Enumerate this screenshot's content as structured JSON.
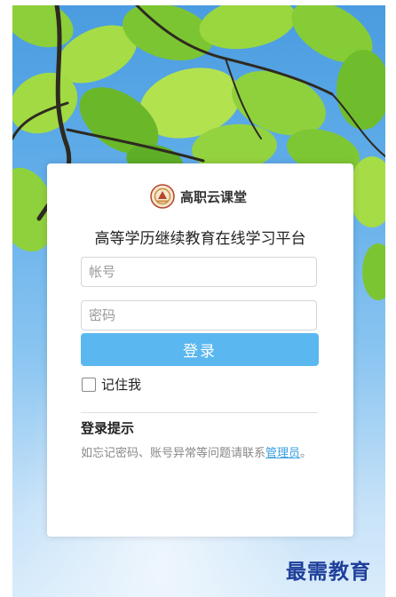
{
  "app": {
    "logo_text": "高职云课堂",
    "subtitle": "高等学历继续教育在线学习平台"
  },
  "login_form": {
    "account_placeholder": "帐号",
    "account_value": "",
    "password_placeholder": "密码",
    "password_value": "",
    "login_button": "登录",
    "remember_label": "记住我",
    "remember_checked": false
  },
  "tip": {
    "title": "登录提示",
    "text": "如忘记密码、账号异常等问题请联系",
    "link": "管理员",
    "end": "。"
  },
  "watermark": "最需教育",
  "colors": {
    "accent": "#5bb7f0",
    "link": "#3aa0e0",
    "watermark": "#1f3f9a",
    "sky_top": "#4a9ce0",
    "sky_bottom": "#d9ecfb"
  }
}
